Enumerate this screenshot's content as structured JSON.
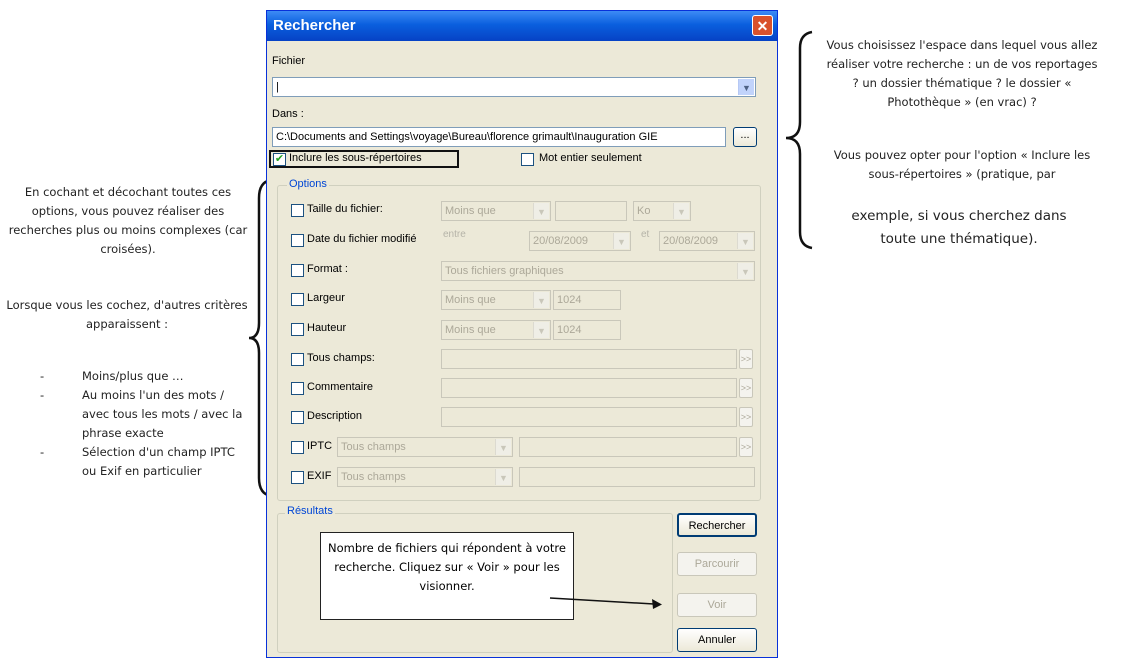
{
  "dialog": {
    "title": "Rechercher",
    "close_glyph": "✕",
    "fichier_label": "Fichier",
    "fichier_value": "|",
    "dans_label": "Dans :",
    "dans_value": "C:\\Documents and Settings\\voyage\\Bureau\\florence grimault\\Inauguration GIE",
    "browse_label": "...",
    "include_sub_label": "Inclure les sous-répertoires",
    "include_sub_checked": true,
    "whole_word_label": "Mot entier seulement",
    "whole_word_checked": false,
    "options": {
      "title": "Options",
      "taille": {
        "label": "Taille du fichier:",
        "op": "Moins que",
        "unit": "Ko"
      },
      "date": {
        "label": "Date du fichier modifié",
        "between": "entre",
        "from": "20/08/2009",
        "and": "et",
        "to": "20/08/2009"
      },
      "format": {
        "label": "Format :",
        "value": "Tous fichiers graphiques"
      },
      "largeur": {
        "label": "Largeur",
        "op": "Moins que",
        "value": "1024"
      },
      "hauteur": {
        "label": "Hauteur",
        "op": "Moins que",
        "value": "1024"
      },
      "tous_champs": {
        "label": "Tous champs:"
      },
      "commentaire": {
        "label": "Commentaire"
      },
      "description": {
        "label": "Description"
      },
      "iptc": {
        "label": "IPTC",
        "value": "Tous champs"
      },
      "exif": {
        "label": "EXIF",
        "value": "Tous champs"
      },
      "more_glyph": ">>"
    },
    "results": {
      "title": "Résultats"
    },
    "buttons": {
      "rechercher": "Rechercher",
      "parcourir": "Parcourir",
      "voir": "Voir",
      "annuler": "Annuler"
    }
  },
  "annotations": {
    "right": {
      "p1": "Vous choisissez l'espace dans lequel vous allez réaliser votre recherche : un de vos reportages ? un dossier thématique ? le dossier « Photothèque » (en vrac) ?",
      "p2": "Vous pouvez opter pour l'option « Inclure les sous-répertoires » (pratique, par",
      "p3": "exemple, si vous cherchez dans toute une thématique)."
    },
    "left": {
      "p1": "En cochant et décochant toutes ces options, vous pouvez réaliser des recherches plus ou moins complexes (car croisées).",
      "p2": "Lorsque vous les cochez, d'autres critères apparaissent :",
      "bullets": [
        "Moins/plus que …",
        "Au moins l'un des mots / avec tous les mots / avec la phrase exacte",
        "Sélection d'un champ IPTC ou Exif en particulier"
      ],
      "bullet_mark": "-"
    },
    "callout": "Nombre de fichiers qui répondent à votre recherche. Cliquez sur « Voir » pour les visionner."
  }
}
